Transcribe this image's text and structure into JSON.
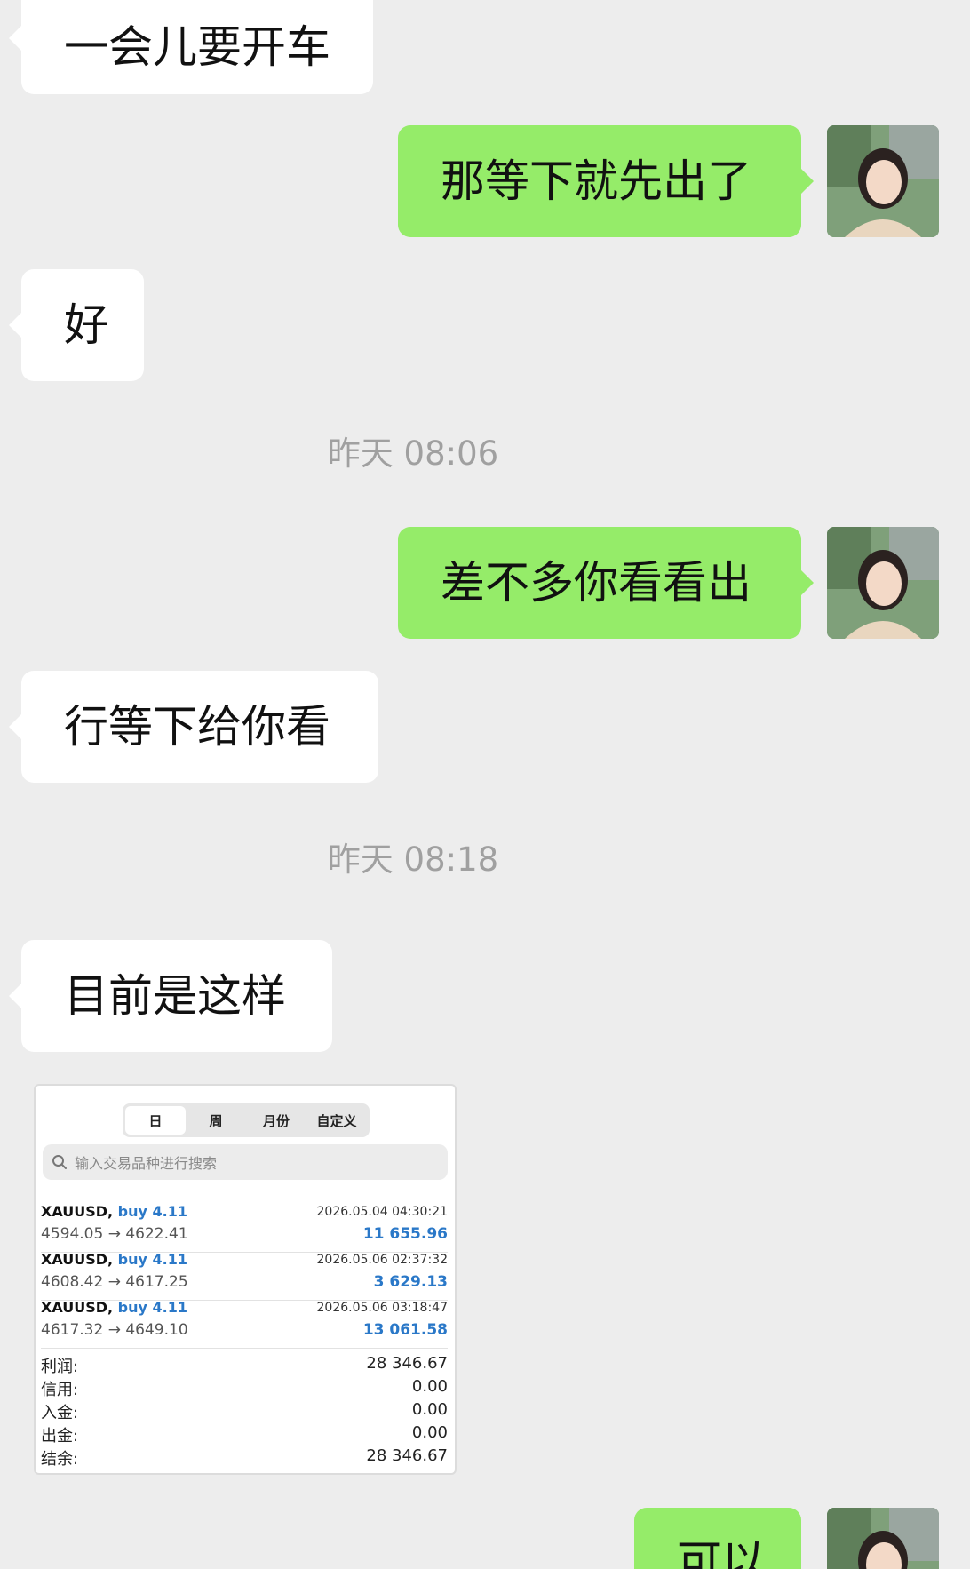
{
  "messages": {
    "m1": "一会儿要开车",
    "m2": "那等下就先出了",
    "m3": "好",
    "t1": "昨天 08:06",
    "m4": "差不多你看看出",
    "m5": "行等下给你看",
    "t2": "昨天 08:18",
    "m6": "目前是这样",
    "m7": "可以"
  },
  "screenshot": {
    "tabs": [
      "日",
      "周",
      "月份",
      "自定义"
    ],
    "active_tab": "日",
    "search_placeholder": "输入交易品种进行搜索",
    "deals": [
      {
        "symbol": "XAUUSD,",
        "side": "buy 4.11",
        "time": "2026.05.04 04:30:21",
        "price": "4594.05 → 4622.41",
        "profit": "11 655.96"
      },
      {
        "symbol": "XAUUSD,",
        "side": "buy 4.11",
        "time": "2026.05.06 02:37:32",
        "price": "4608.42 → 4617.25",
        "profit": "3 629.13"
      },
      {
        "symbol": "XAUUSD,",
        "side": "buy 4.11",
        "time": "2026.05.06 03:18:47",
        "price": "4617.32 → 4649.10",
        "profit": "13 061.58"
      }
    ],
    "summary": [
      {
        "label": "利润:",
        "value": "28 346.67"
      },
      {
        "label": "信用:",
        "value": "0.00"
      },
      {
        "label": "入金:",
        "value": "0.00"
      },
      {
        "label": "出金:",
        "value": "0.00"
      },
      {
        "label": "结余:",
        "value": "28 346.67"
      }
    ]
  },
  "colors": {
    "background": "#ededed",
    "incoming_bubble": "#ffffff",
    "outgoing_bubble": "#95ec69",
    "timestamp_text": "#a0a0a0",
    "accent_blue": "#2a78c8"
  }
}
